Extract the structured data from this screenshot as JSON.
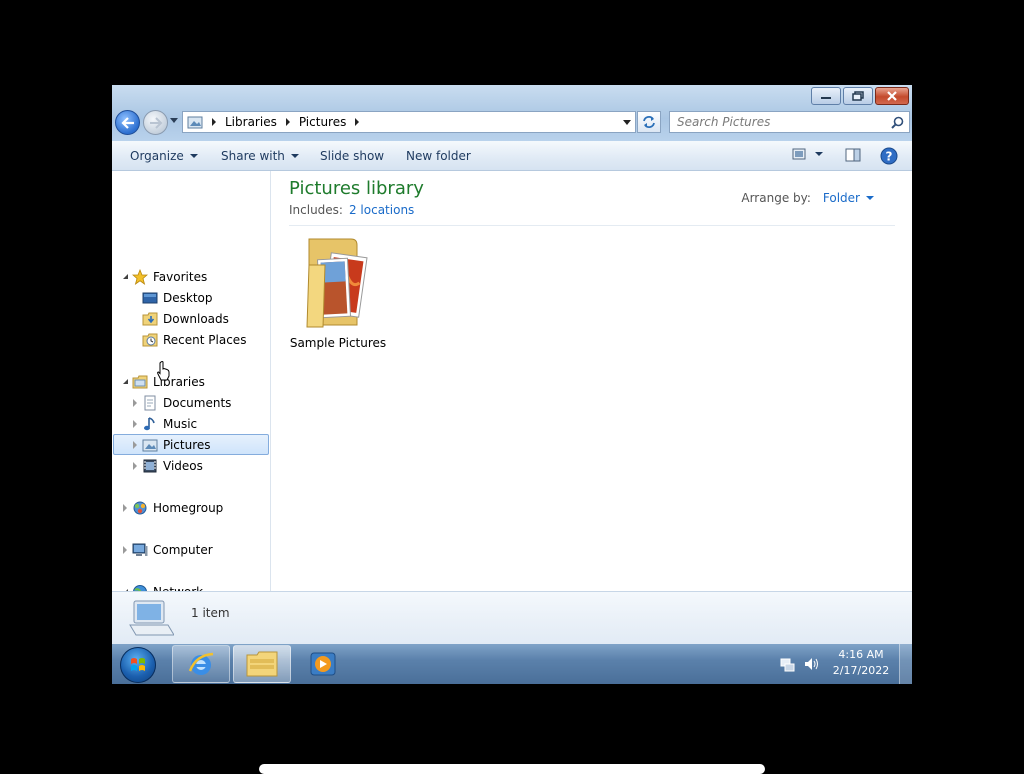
{
  "window": {
    "address": {
      "crumbs": [
        "Libraries",
        "Pictures"
      ]
    },
    "search": {
      "placeholder": "Search Pictures"
    },
    "caption_buttons": [
      "minimize-icon",
      "maximize-icon",
      "close-icon"
    ]
  },
  "toolbar": {
    "organize": "Organize",
    "share_with": "Share with",
    "slide_show": "Slide show",
    "new_folder": "New folder"
  },
  "nav": {
    "favorites": {
      "label": "Favorites",
      "items": [
        "Desktop",
        "Downloads",
        "Recent Places"
      ]
    },
    "libraries": {
      "label": "Libraries",
      "items": [
        "Documents",
        "Music",
        "Pictures",
        "Videos"
      ],
      "selected": "Pictures"
    },
    "homegroup": "Homegroup",
    "computer": "Computer",
    "network": {
      "label": "Network",
      "items": [
        ""
      ]
    }
  },
  "content": {
    "title": "Pictures library",
    "includes_label": "Includes:",
    "includes_link": "2 locations",
    "arrange_label": "Arrange by:",
    "arrange_value": "Folder",
    "items": [
      {
        "name": "Sample Pictures",
        "icon": "picture-folder-icon"
      }
    ]
  },
  "details": {
    "count": "1 item"
  },
  "taskbar": {
    "apps": [
      "internet-explorer-icon",
      "windows-explorer-icon",
      "media-player-icon"
    ],
    "time": "4:16 AM",
    "date": "2/17/2022"
  },
  "colors": {
    "title_green": "#1e7b2c",
    "link_blue": "#1a6bc9",
    "selection_border": "#84acdd"
  }
}
